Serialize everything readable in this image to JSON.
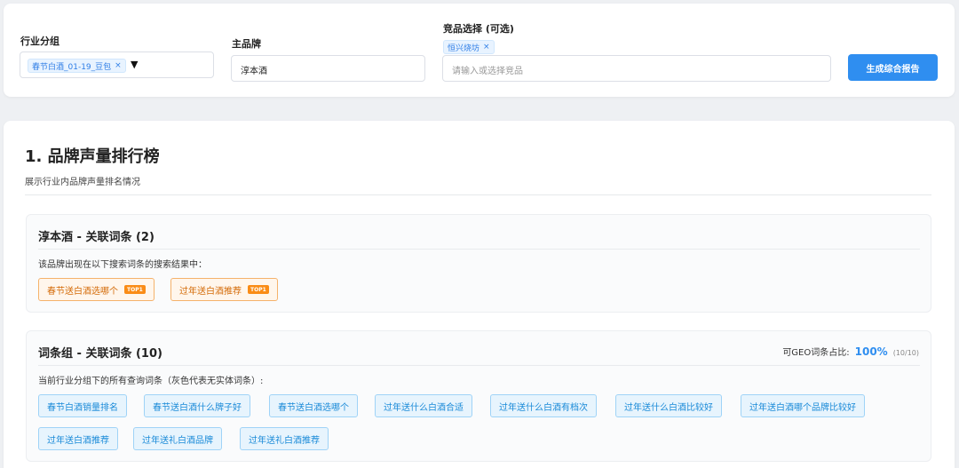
{
  "filters": {
    "industry_group": {
      "label": "行业分组",
      "selected_tag": "春节白酒_01-19_豆包",
      "remove_icon": "×",
      "dropdown_icon": "▼"
    },
    "main_brand": {
      "label": "主品牌",
      "value": "淳本酒"
    },
    "competitor": {
      "label": "竞品选择 (可选)",
      "selected_tag": "恒兴烧坊",
      "remove_icon": "×",
      "placeholder": "请输入或选择竞品"
    },
    "generate_button": "生成综合报告"
  },
  "section": {
    "title": "1. 品牌声量排行榜",
    "subtitle": "展示行业内品牌声量排名情况"
  },
  "brand_panel": {
    "title": "淳本酒 - 关联词条 (2)",
    "description": "该品牌出现在以下搜索词条的搜索结果中：",
    "chips": [
      {
        "text": "春节送白酒选哪个",
        "badge": "TOP1"
      },
      {
        "text": "过年送白酒推荐",
        "badge": "TOP1"
      }
    ]
  },
  "group_panel": {
    "title": "词条组 - 关联词条 (10)",
    "geo_label": "可GEO词条占比:",
    "geo_percent": "100%",
    "geo_count": "(10/10)",
    "description": "当前行业分组下的所有查询词条（灰色代表无实体词条）:",
    "chips": [
      "春节白酒销量排名",
      "春节送白酒什么牌子好",
      "春节送白酒选哪个",
      "过年送什么白酒合适",
      "过年送什么白酒有档次",
      "过年送什么白酒比较好",
      "过年送白酒哪个品牌比较好",
      "过年送白酒推荐",
      "过年送礼白酒品牌",
      "过年送礼白酒推荐"
    ]
  },
  "colors": {
    "primary": "#2f8ef0",
    "tag_blue": "#1a8ad8",
    "tag_orange": "#d46b08",
    "badge_orange": "#fa8c16"
  }
}
